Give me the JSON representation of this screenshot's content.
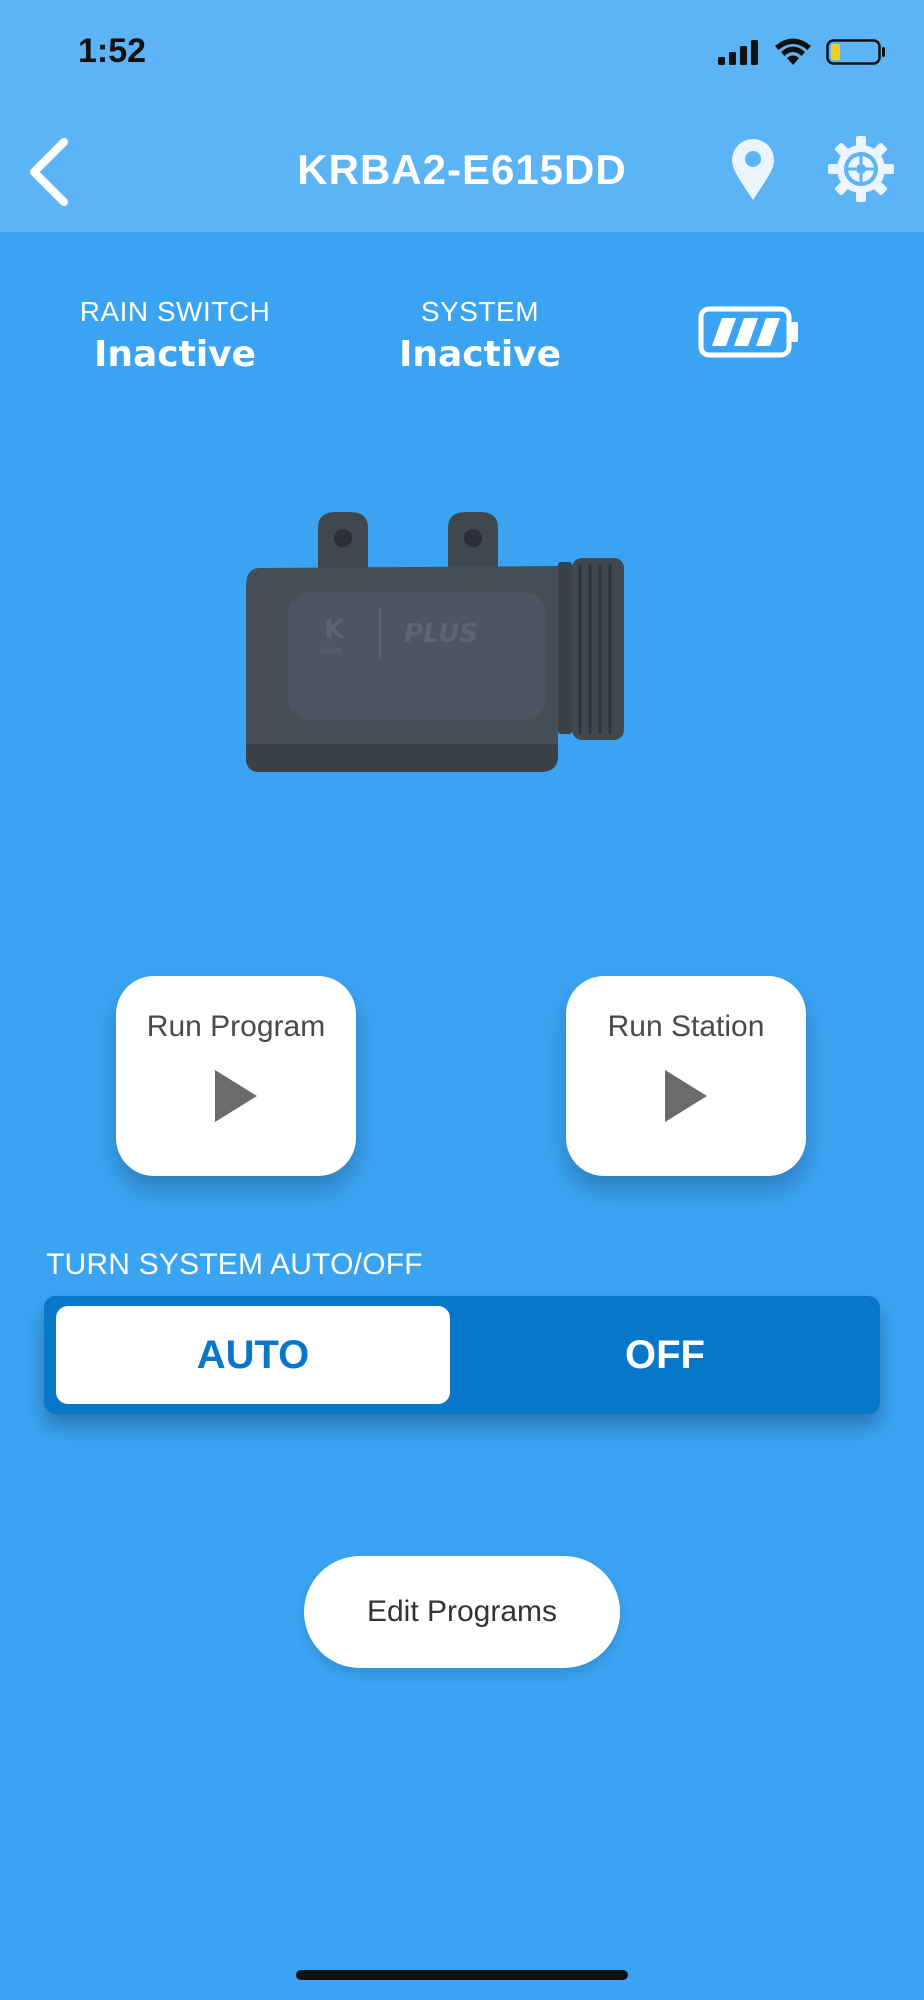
{
  "status_bar": {
    "time": "1:52"
  },
  "header": {
    "title": "KRBA2-E615DD",
    "icons": [
      "back-arrow-icon",
      "location-pin-icon",
      "gear-icon"
    ]
  },
  "status": {
    "rain_switch": {
      "label": "RAIN SWITCH",
      "value": "Inactive"
    },
    "system": {
      "label": "SYSTEM",
      "value": "Inactive"
    },
    "battery_icon": "battery-full-icon"
  },
  "device": {
    "brand_text": "K RAIN",
    "model_text": "PLUS"
  },
  "actions": {
    "run_program": "Run Program",
    "run_station": "Run Station"
  },
  "toggle": {
    "heading": "TURN SYSTEM AUTO/OFF",
    "auto_label": "AUTO",
    "off_label": "OFF",
    "selected": "AUTO"
  },
  "edit_programs": "Edit Programs",
  "colors": {
    "background": "#3aa3f2",
    "header": "#5cb3f5",
    "toggle_dark": "#0876c9"
  }
}
